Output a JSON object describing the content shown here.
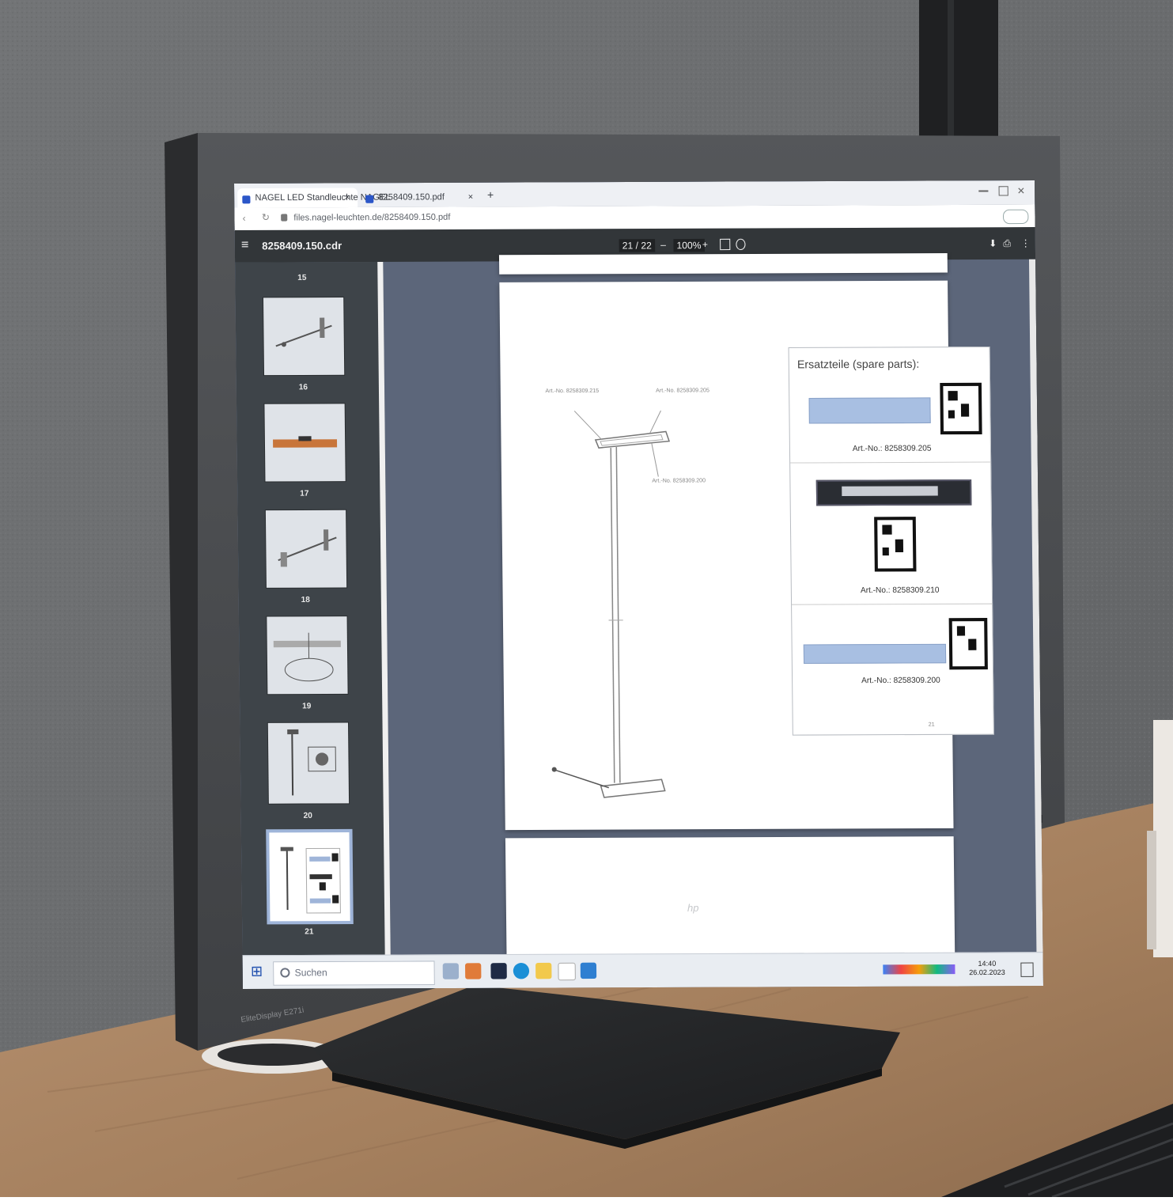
{
  "browser": {
    "tabs": [
      {
        "label": "NAGEL LED Standleuchte NAGEL",
        "close_glyph": "×"
      },
      {
        "label": "8258409.150.pdf",
        "close_glyph": "×"
      }
    ],
    "new_tab_glyph": "+",
    "address": "files.nagel-leuchten.de/8258409.150.pdf"
  },
  "pdf_viewer": {
    "menu_glyph": "≡",
    "file_name": "8258409.150.cdr",
    "page_indicator": "21 / 22",
    "zoom_out": "–",
    "zoom_level": "100%",
    "zoom_in": "+",
    "download_glyph": "⬇",
    "print_glyph": "⎙",
    "more_glyph": "⋮",
    "thumbnails": [
      {
        "number": "15"
      },
      {
        "number": "16"
      },
      {
        "number": "17"
      },
      {
        "number": "18"
      },
      {
        "number": "19"
      },
      {
        "number": "20"
      },
      {
        "number": "21",
        "selected": true
      }
    ],
    "page": {
      "spare_parts_title": "Ersatzteile (spare parts):",
      "parts": [
        {
          "art_no": "Art.-No.: 8258309.205"
        },
        {
          "art_no": "Art.-No.: 8258309.210"
        },
        {
          "art_no": "Art.-No.: 8258309.200"
        }
      ],
      "callouts": [
        {
          "text": "Art.-No. 8258309.215"
        },
        {
          "text": "Art.-No. 8258309.205"
        },
        {
          "text": "Art.-No. 8258309.200"
        }
      ],
      "page_number": "21"
    }
  },
  "taskbar": {
    "start_glyph": "⊞",
    "search_placeholder": "Suchen",
    "time": "14:40",
    "date": "26.02.2023"
  },
  "monitor": {
    "brand": "hp",
    "model": "EliteDisplay E271i"
  },
  "colors": {
    "wall": "#6e7072",
    "desk": "#a98461",
    "bezel": "#4a4c4f",
    "stand": "#232426",
    "viewer_background": "#5c667a",
    "accent": "#2b56c8"
  }
}
